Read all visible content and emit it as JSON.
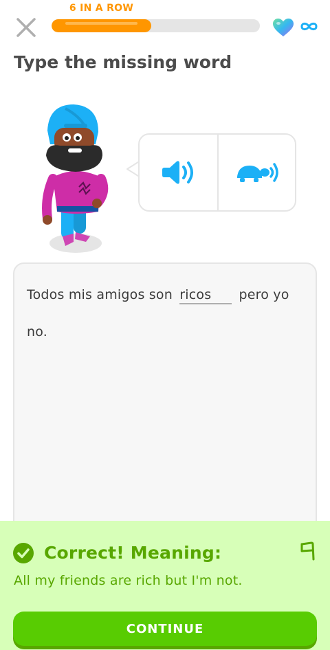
{
  "header": {
    "streak_label": "6 IN A ROW",
    "progress_fraction": 0.48,
    "hearts_value": "∞",
    "colors": {
      "streak": "#ff9600",
      "track": "#e5e5e5",
      "infinity": "#1cb0f6"
    }
  },
  "challenge": {
    "title": "Type the missing word",
    "sentence_before": "Todos mis amigos son",
    "answer_value": "ricos",
    "sentence_after": "pero yo no.",
    "icons": {
      "normal_audio": "speaker-icon",
      "slow_audio": "turtle-icon"
    }
  },
  "feedback": {
    "status_title": "Correct! Meaning:",
    "meaning": "All my friends are rich but I'm not.",
    "continue_label": "CONTINUE",
    "colors": {
      "background": "#d7ffb8",
      "text": "#58a700",
      "button": "#58cc02"
    }
  }
}
